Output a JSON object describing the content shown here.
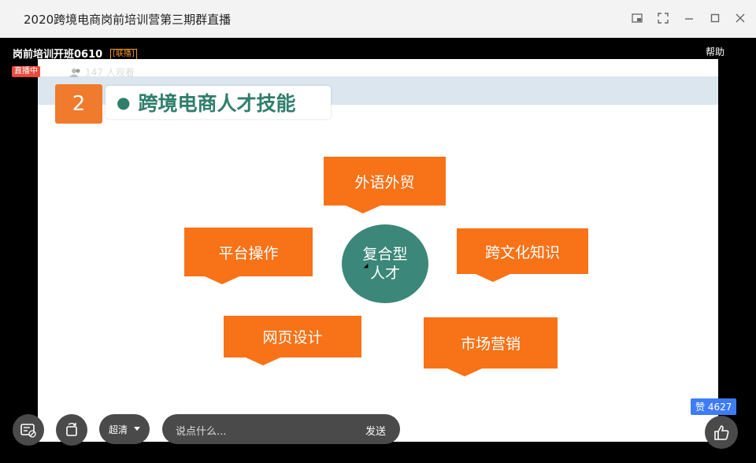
{
  "window": {
    "title": "2020跨境电商岗前培训营第三期群直播",
    "controls": [
      "pip-icon",
      "fullscreen-icon",
      "minimize-icon",
      "maximize-icon",
      "close-icon"
    ]
  },
  "room": {
    "name": "岗前培训开班0610",
    "tag": "[联播]",
    "help": "帮助",
    "live_status": "直播中",
    "viewer_count": "147",
    "viewer_suffix": "人观看"
  },
  "slide": {
    "number": "2",
    "heading": "跨境电商人才技能",
    "center": {
      "line1": "复合型",
      "line2": "人才"
    },
    "skills": [
      "外语外贸",
      "平台操作",
      "跨文化知识",
      "网页设计",
      "市场营销"
    ],
    "colors": {
      "card": "#f87217",
      "center": "#3b8779",
      "heading": "#2f7e6c",
      "number_box": "#f07b2c"
    }
  },
  "controls": {
    "quality": "超清",
    "chat_placeholder": "说点什么...",
    "send": "发送",
    "likes_label": "赞",
    "likes": "4627"
  }
}
